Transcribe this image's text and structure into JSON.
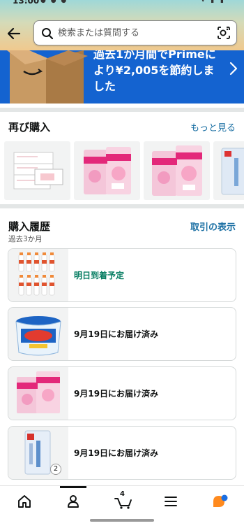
{
  "status_bar": {
    "time": "13:00",
    "left_icons": "● ● ●",
    "right_icons": "▾ ▮ ▮"
  },
  "search": {
    "placeholder": "検索または質問する"
  },
  "banner": {
    "text": "過去1か月間でPrimeにより¥2,005を節約しました"
  },
  "buy_again": {
    "title": "再び購入",
    "see_more": "もっと見る"
  },
  "history": {
    "title": "購入履歴",
    "view_transactions": "取引の表示",
    "period": "過去3か月",
    "orders": [
      {
        "status": "明日到着予定",
        "product_icon": "drink-bottles"
      },
      {
        "status": "9月19日にお届け済み",
        "product_icon": "oxiclean-tub"
      },
      {
        "status": "9月19日にお届け済み",
        "product_icon": "scottie-toilet-paper"
      },
      {
        "status": "9月19日にお届け済み",
        "product_icon": "rice-bag",
        "quantity": "2"
      }
    ]
  },
  "nav": {
    "cart_count": "4",
    "items": [
      "home-icon",
      "account-icon",
      "cart-icon",
      "menu-icon",
      "rufus-icon"
    ]
  },
  "colors": {
    "banner_blue": "#1463d0",
    "link_blue": "#1a6fa3",
    "delivery_green": "#067d62"
  }
}
